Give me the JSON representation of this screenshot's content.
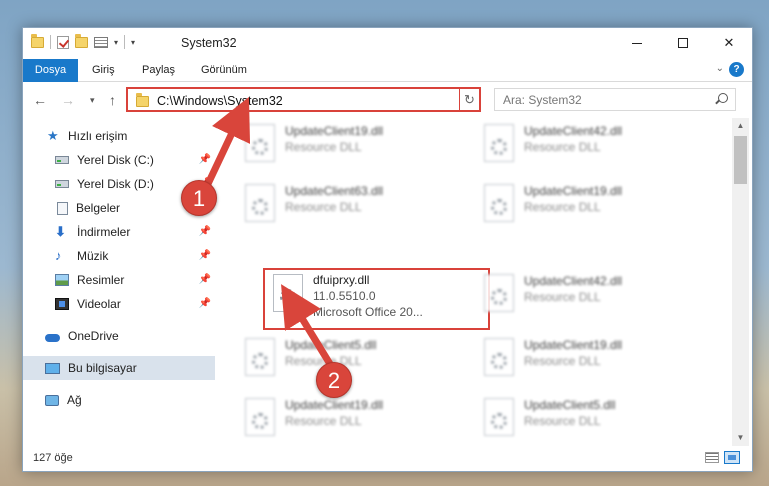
{
  "window": {
    "title": "System32",
    "controls": {
      "minimize": "—",
      "maximize": "□",
      "close": "✕"
    }
  },
  "ribbon": {
    "tabs": [
      "Dosya",
      "Giriş",
      "Paylaş",
      "Görünüm"
    ],
    "help": "?"
  },
  "navbar": {
    "address": "C:\\Windows\\System32",
    "search_placeholder": "Ara: System32"
  },
  "sidebar": {
    "items": [
      {
        "label": "Hızlı erişim",
        "icon": "star-icon",
        "pinned": false
      },
      {
        "label": "Yerel Disk (C:)",
        "icon": "drive-icon",
        "pinned": true
      },
      {
        "label": "Yerel Disk (D:)",
        "icon": "drive-icon",
        "pinned": true
      },
      {
        "label": "Belgeler",
        "icon": "documents-icon",
        "pinned": true
      },
      {
        "label": "İndirmeler",
        "icon": "downloads-icon",
        "pinned": true
      },
      {
        "label": "Müzik",
        "icon": "music-icon",
        "pinned": true
      },
      {
        "label": "Resimler",
        "icon": "pictures-icon",
        "pinned": true
      },
      {
        "label": "Videolar",
        "icon": "videos-icon",
        "pinned": true
      },
      {
        "label": "OneDrive",
        "icon": "onedrive-icon",
        "pinned": false
      },
      {
        "label": "Bu bilgisayar",
        "icon": "this-pc-icon",
        "pinned": false,
        "selected": true
      },
      {
        "label": "Ağ",
        "icon": "network-icon",
        "pinned": false
      }
    ]
  },
  "files": [
    {
      "name": "UpdateClient19.dll",
      "desc": "Resource DLL"
    },
    {
      "name": "UpdateClient42.dll",
      "desc": "Resource DLL"
    },
    {
      "name": "UpdateClient63.dll",
      "desc": "Resource DLL"
    },
    {
      "name": "UpdateClient19.dll",
      "desc": "Resource DLL"
    },
    {
      "name": "dfuiprxy.dll",
      "desc": "11.0.5510.0",
      "desc2": "Microsoft Office 20..."
    },
    {
      "name": "UpdateClient42.dll",
      "desc": "Resource DLL"
    },
    {
      "name": "UpdateClient5.dll",
      "desc": "Resource DLL"
    },
    {
      "name": "UpdateClient19.dll",
      "desc": "Resource DLL"
    },
    {
      "name": "UpdateClient19.dll",
      "desc": "Resource DLL"
    },
    {
      "name": "UpdateClient5.dll",
      "desc": "Resource DLL"
    }
  ],
  "status": {
    "count": "127 öğe"
  },
  "callouts": [
    "1",
    "2"
  ],
  "colors": {
    "accent": "#1979ca",
    "highlight": "#d9423a"
  }
}
